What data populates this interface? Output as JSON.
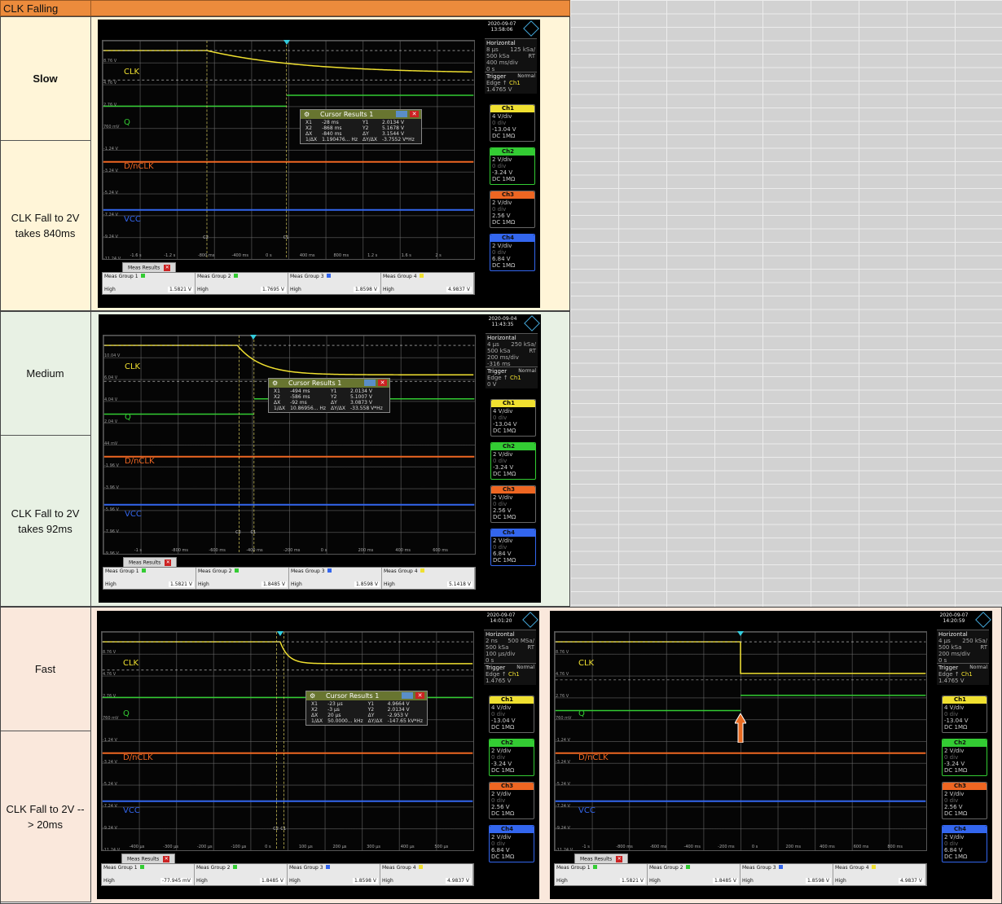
{
  "header": {
    "title": "CLK Falling"
  },
  "rows": [
    {
      "speed": "Slow",
      "desc": "CLK Fall to 2V takes 840ms"
    },
    {
      "speed": "Medium",
      "desc": "CLK Fall to 2V takes 92ms"
    },
    {
      "speed": "Fast",
      "desc": "CLK Fall to 2V --> 20ms"
    }
  ],
  "channels": {
    "clk": "CLK",
    "q": "Q",
    "dnclk": "D/nCLK",
    "vcc": "VCC"
  },
  "colors": {
    "ch1": "#f0e030",
    "ch2": "#33cc33",
    "ch3": "#ee6622",
    "ch4": "#3366ee"
  },
  "labels": {
    "meas_results": "Meas Results",
    "high": "High",
    "horizontal": "Horizontal",
    "trigger": "Trigger",
    "normal": "Normal",
    "edge": "Edge",
    "rt": "RT",
    "cursor_title": "Cursor Results 1",
    "c1": "C1",
    "c2": "C2"
  },
  "scopes": [
    {
      "date": "2020-09-07",
      "time": "13:58:06",
      "h1": "8 µs",
      "h2": "125 kSa/",
      "h3": "500 kSa",
      "h4": "400 ms/div",
      "h5": "0 s",
      "trig": "1.4765 V",
      "levels": [
        "8.76 V",
        "4.76 V",
        "2.76 V",
        "760 mV",
        "-1.24 V",
        "-3.24 V",
        "-5.24 V",
        "-7.24 V",
        "-9.24 V",
        "-11.24 V",
        "-13.24 V"
      ],
      "ticks": [
        "-1.6 s",
        "-1.2 s",
        "-800 ms",
        "-400 ms",
        "0 s",
        "400 ms",
        "800 ms",
        "1.2 s",
        "1.6 s",
        "2 s"
      ],
      "cursor": [
        [
          "X1",
          "-28 ms",
          "Y1",
          "2.0134 V"
        ],
        [
          "X2",
          "-868 ms",
          "Y2",
          "5.1678 V"
        ],
        [
          "ΔX",
          "-840 ms",
          "ΔY",
          "3.1544 V"
        ],
        [
          "1/ΔX",
          "1.190476... Hz",
          "ΔY/ΔX",
          "-3.7552 V*Hz"
        ]
      ],
      "meas": [
        "1.5821 V",
        "1.7695 V",
        "1.8598 V",
        "4.9837 V"
      ]
    },
    {
      "date": "2020-09-04",
      "time": "11:43:35",
      "h1": "4 µs",
      "h2": "250 kSa/",
      "h3": "500 kSa",
      "h4": "200 ms/div",
      "h5": "-316 ms",
      "trig": "0 V",
      "levels": [
        "10.04 V",
        "6.04 V",
        "4.04 V",
        "2.04 V",
        "44 mV",
        "-1.96 V",
        "-3.96 V",
        "-5.96 V",
        "-7.96 V",
        "-9.96 V",
        "-11.96 V"
      ],
      "ticks": [
        "-1 s",
        "-800 ms",
        "-600 ms",
        "-400 ms",
        "-200 ms",
        "0 s",
        "200 ms",
        "400 ms",
        "600 ms"
      ],
      "cursor": [
        [
          "X1",
          "-494 ms",
          "Y1",
          "2.0134 V"
        ],
        [
          "X2",
          "-586 ms",
          "Y2",
          "5.1007 V"
        ],
        [
          "ΔX",
          "-92 ms",
          "ΔY",
          "3.0873 V"
        ],
        [
          "1/ΔX",
          "10.86956... Hz",
          "ΔY/ΔX",
          "-33.558 V*Hz"
        ]
      ],
      "meas": [
        "1.5821 V",
        "1.8485 V",
        "1.8598 V",
        "5.1418 V"
      ]
    },
    {
      "date": "2020-09-07",
      "time": "14:01:20",
      "h1": "2 ns",
      "h2": "500 MSa/",
      "h3": "500 kSa",
      "h4": "100 µs/div",
      "h5": "0 s",
      "trig": "1.4765 V",
      "levels": [
        "8.76 V",
        "4.76 V",
        "2.76 V",
        "760 mV",
        "-1.24 V",
        "-3.24 V",
        "-5.24 V",
        "-7.24 V",
        "-9.24 V",
        "-11.24 V",
        "-13.24 V"
      ],
      "ticks": [
        "-400 µs",
        "-300 µs",
        "-200 µs",
        "-100 µs",
        "0 s",
        "100 µs",
        "200 µs",
        "300 µs",
        "400 µs",
        "500 µs"
      ],
      "cursor": [
        [
          "X1",
          "-23 µs",
          "Y1",
          "4.9664 V"
        ],
        [
          "X2",
          "-3 µs",
          "Y2",
          "2.0134 V"
        ],
        [
          "ΔX",
          "20 µs",
          "ΔY",
          "-2.953 V"
        ],
        [
          "1/ΔX",
          "50.0000... kHz",
          "ΔY/ΔX",
          "-147.65 kV*Hz"
        ]
      ],
      "meas": [
        "-77.945 mV",
        "1.8485 V",
        "1.8598 V",
        "4.9837 V"
      ]
    },
    {
      "date": "2020-09-07",
      "time": "14:20:59",
      "h1": "4 µs",
      "h2": "250 kSa/",
      "h3": "500 kSa",
      "h4": "200 ms/div",
      "h5": "0 s",
      "trig": "1.4765 V",
      "levels": [
        "8.76 V",
        "4.76 V",
        "2.76 V",
        "760 mV",
        "-1.24 V",
        "-3.24 V",
        "-5.24 V",
        "-7.24 V",
        "-9.24 V",
        "-11.24 V",
        "-13.24 V"
      ],
      "ticks": [
        "-1 s",
        "-800 ms",
        "-600 ms",
        "-400 ms",
        "-200 ms",
        "0 s",
        "200 ms",
        "400 ms",
        "600 ms",
        "800 ms"
      ],
      "meas": [
        "1.5821 V",
        "1.8485 V",
        "1.8598 V",
        "4.9837 V"
      ]
    }
  ],
  "chinfo": {
    "ch1": {
      "name": "Ch1",
      "vdiv": "4 V/div",
      "off": "0 div",
      "lvl": "-13.04 V",
      "cpl": "DC 1MΩ"
    },
    "ch2": {
      "name": "Ch2",
      "vdiv": "2 V/div",
      "off": "0 div",
      "lvl": "-3.24 V",
      "cpl": "DC 1MΩ"
    },
    "ch3": {
      "name": "Ch3",
      "vdiv": "2 V/div",
      "off": "0 div",
      "lvl": "2.56 V",
      "cpl": "DC 1MΩ"
    },
    "ch4": {
      "name": "Ch4",
      "vdiv": "2 V/div",
      "off": "0 div",
      "lvl": "6.84 V",
      "cpl": "DC 1MΩ"
    }
  },
  "groups": [
    "Meas Group 1",
    "Meas Group 2",
    "Meas Group 3",
    "Meas Group 4"
  ]
}
